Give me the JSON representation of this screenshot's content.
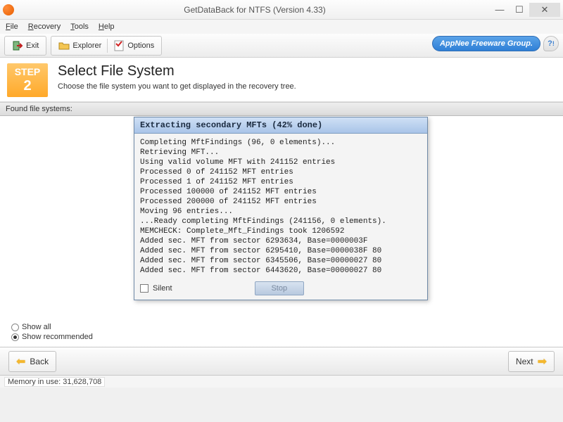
{
  "window": {
    "title": "GetDataBack for NTFS (Version 4.33)"
  },
  "menu": {
    "file": "File",
    "recovery": "Recovery",
    "tools": "Tools",
    "help": "Help"
  },
  "toolbar": {
    "exit": "Exit",
    "explorer": "Explorer",
    "options": "Options",
    "brand": "AppNee Freeware Group."
  },
  "step": {
    "word": "STEP",
    "num": "2",
    "title": "Select File System",
    "subtitle": "Choose the file system you want to get displayed in the recovery tree."
  },
  "panel": {
    "found_label": "Found file systems:"
  },
  "dialog": {
    "title": "Extracting secondary MFTs (42% done)",
    "log_lines": [
      "Completing MftFindings (96, 0 elements)...",
      "Retrieving MFT...",
      "Using valid volume MFT with 241152 entries",
      "Processed 0 of 241152 MFT entries",
      "Processed 1 of 241152 MFT entries",
      "Processed 100000 of 241152 MFT entries",
      "Processed 200000 of 241152 MFT entries",
      "Moving 96 entries...",
      "...Ready completing MftFindings (241156, 0 elements).",
      "MEMCHECK: Complete_Mft_Findings took 1206592",
      "Added sec. MFT from sector 6293634, Base=0000003F",
      "Added sec. MFT from sector 6295410, Base=0000038F 80",
      "Added sec. MFT from sector 6345506, Base=00000027 80",
      "Added sec. MFT from sector 6443620, Base=00000027 80"
    ],
    "silent_label": "Silent",
    "stop_label": "Stop"
  },
  "radios": {
    "show_all": "Show all",
    "show_recommended": "Show recommended"
  },
  "nav": {
    "back": "Back",
    "next": "Next"
  },
  "status": {
    "memory_label": "Memory in use: 31,628,708"
  }
}
